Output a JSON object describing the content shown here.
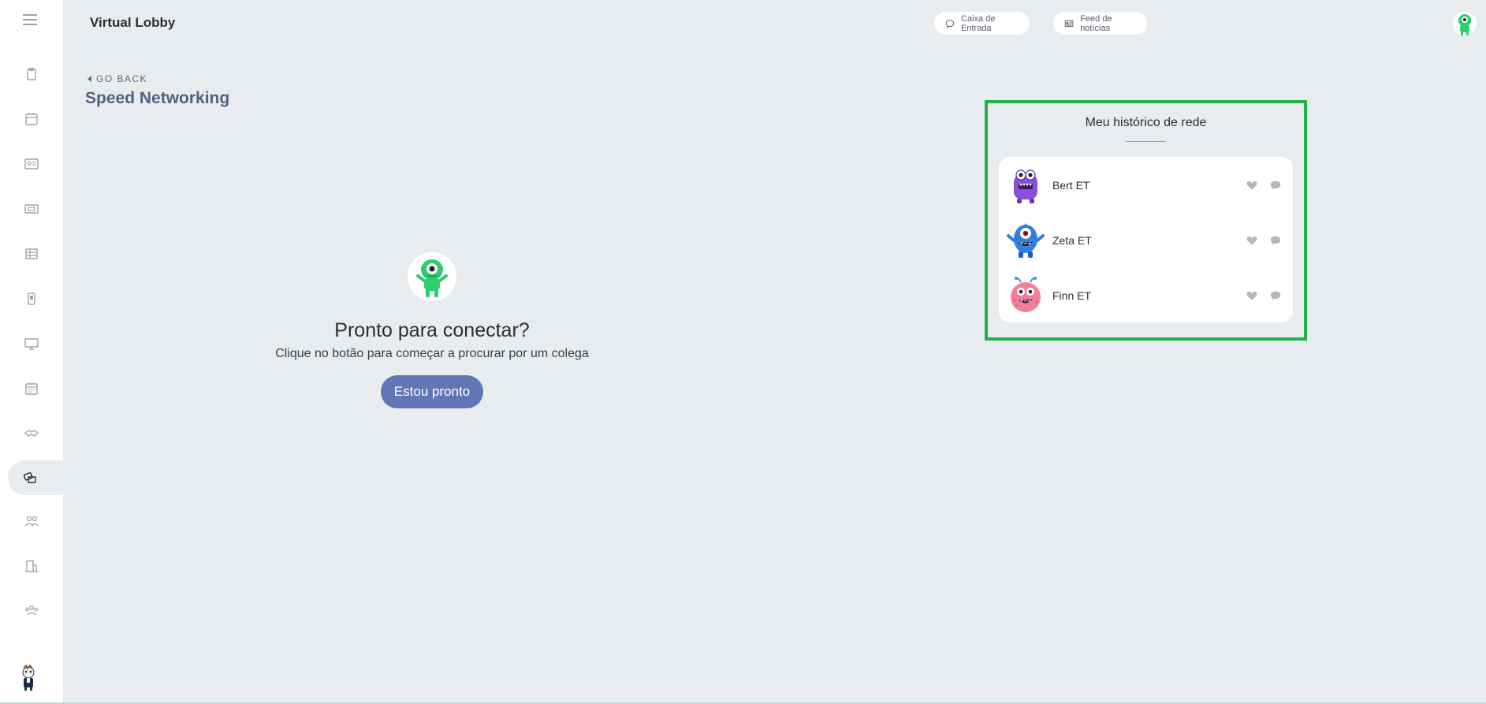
{
  "app": {
    "title": "Virtual Lobby"
  },
  "topbar": {
    "inbox_label": "Caixa de Entrada",
    "feed_label": "Feed de notícias"
  },
  "sidebar": {
    "items": [
      {
        "icon": "clipboard-icon"
      },
      {
        "icon": "calendar-icon"
      },
      {
        "icon": "id-card-icon"
      },
      {
        "icon": "ticket-icon"
      },
      {
        "icon": "table-icon"
      },
      {
        "icon": "mobile-icon"
      },
      {
        "icon": "monitor-icon"
      },
      {
        "icon": "schedule-icon"
      },
      {
        "icon": "handshake-icon"
      },
      {
        "icon": "speed-networking-icon",
        "active": true
      },
      {
        "icon": "people-icon"
      },
      {
        "icon": "building-icon"
      },
      {
        "icon": "group-icon"
      }
    ]
  },
  "page": {
    "go_back": "GO BACK",
    "title": "Speed Networking"
  },
  "ready": {
    "title": "Pronto para conectar?",
    "subtitle": "Clique no botão para começar a procurar por um colega",
    "button": "Estou pronto"
  },
  "history": {
    "title": "Meu histórico de rede",
    "contacts": [
      {
        "name": "Bert ET",
        "avatar": "purple-monster-avatar"
      },
      {
        "name": "Zeta ET",
        "avatar": "blue-monster-avatar"
      },
      {
        "name": "Finn ET",
        "avatar": "pink-monster-avatar"
      }
    ]
  },
  "colors": {
    "accent": "#6275b4",
    "highlight_border": "#22b14c",
    "background": "#e8ecef",
    "title_blue": "#4f6481"
  }
}
